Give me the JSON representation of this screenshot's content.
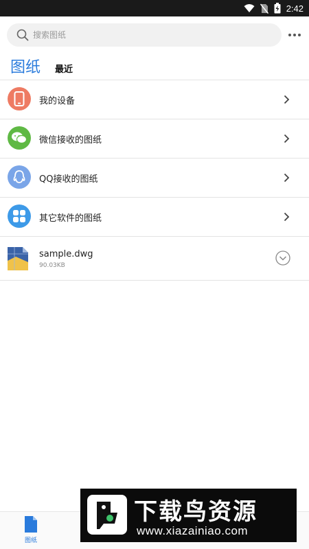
{
  "status_bar": {
    "time": "2:42"
  },
  "search": {
    "placeholder": "搜索图纸"
  },
  "tabs": {
    "main": "图纸",
    "recent": "最近"
  },
  "locations": [
    {
      "label": "我的设备",
      "icon": "phone-icon",
      "color": "#ee7b63"
    },
    {
      "label": "微信接收的图纸",
      "icon": "wechat-icon",
      "color": "#5fb944"
    },
    {
      "label": "QQ接收的图纸",
      "icon": "qq-icon",
      "color": "#7aa5e8"
    },
    {
      "label": "其它软件的图纸",
      "icon": "apps-grid-icon",
      "color": "#3d9ae8"
    }
  ],
  "file": {
    "name": "sample.dwg",
    "size": "90.03KB",
    "icon": "dwg-file-icon"
  },
  "bottom_nav": {
    "tab_label": "图纸"
  },
  "watermark": {
    "title": "下载鸟资源",
    "url": "www.xiazainiao.com"
  },
  "colors": {
    "accent": "#2a7bdc",
    "status_bar": "#1a1a1a"
  }
}
